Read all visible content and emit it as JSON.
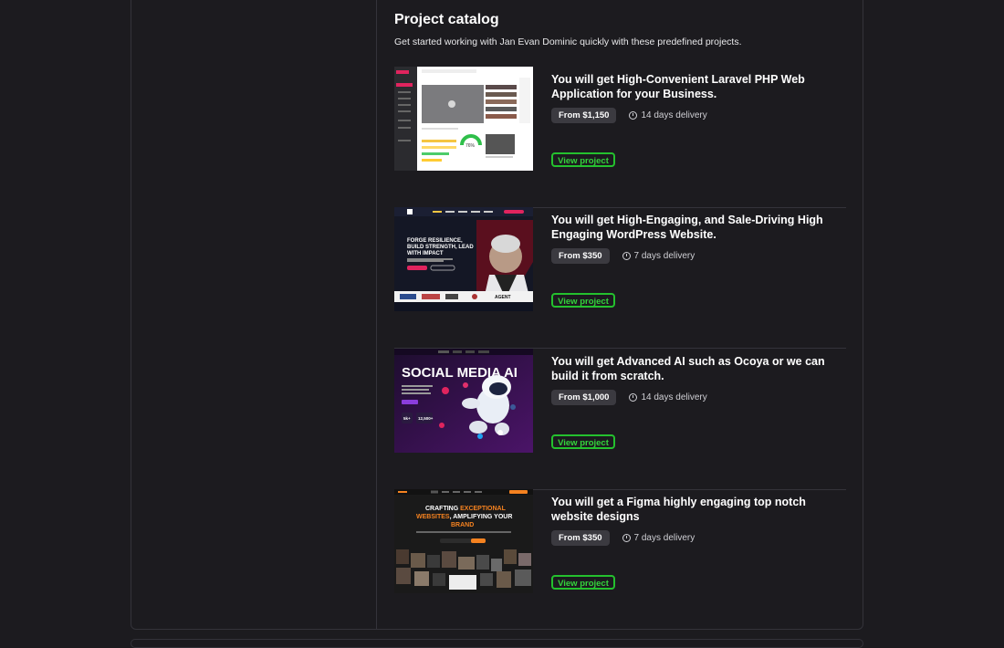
{
  "catalog": {
    "title": "Project catalog",
    "subtitle": "Get started working with Jan Evan Dominic quickly with these predefined projects."
  },
  "projects": [
    {
      "title": "You will get High-Convenient Laravel PHP Web Application for your Business.",
      "price": "From $1,150",
      "delivery": "14 days delivery",
      "button": "View project",
      "thumbnail": {
        "gauge_value": "76%"
      }
    },
    {
      "title": "You will get High-Engaging, and Sale-Driving High Engaging WordPress Website.",
      "price": "From $350",
      "delivery": "7 days delivery",
      "button": "View project",
      "thumbnail": {
        "headline": "FORGE RESILIENCE, BUILD STRENGTH, LEAD WITH IMPACT",
        "logo": "AGENT"
      }
    },
    {
      "title": "You will get Advanced AI such as Ocoya or we can build it from scratch.",
      "price": "From $1,000",
      "delivery": "14 days delivery",
      "button": "View project",
      "thumbnail": {
        "headline": "SOCIAL MEDIA AI",
        "stat_1": "5k+",
        "stat_2": "12,500+"
      }
    },
    {
      "title": "You will get a Figma highly engaging top notch website designs",
      "price": "From $350",
      "delivery": "7 days delivery",
      "button": "View project",
      "thumbnail": {
        "headline_line1": "CRAFTING ",
        "headline_accent1": "EXCEPTIONAL",
        "headline_line2a": "WEBSITES",
        "headline_line2b": ", AMPLIFYING YOUR",
        "headline_accent2": "BRAND"
      }
    }
  ],
  "colors": {
    "background": "#1c1b1f",
    "accent_green": "#24c12e",
    "price_pill": "#3b3a40"
  }
}
